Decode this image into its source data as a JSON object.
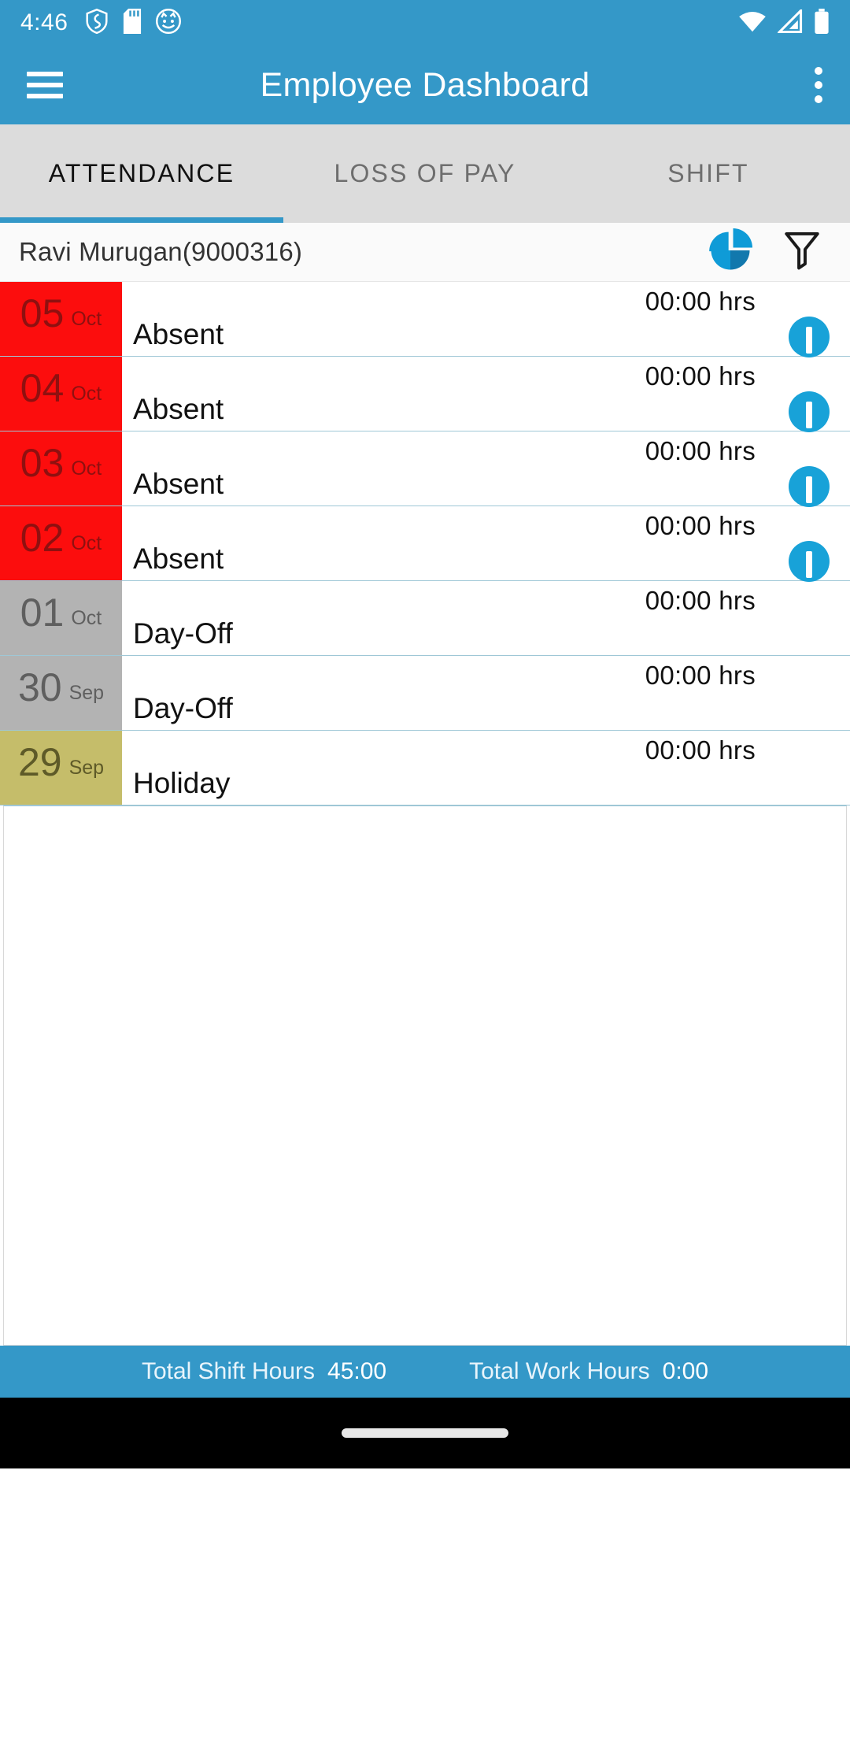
{
  "status_bar": {
    "time": "4:46",
    "left_icons": [
      "shield-icon",
      "sd-card-icon",
      "cat-face-icon"
    ],
    "right_icons": [
      "wifi-icon",
      "cellular-signal-icon",
      "battery-icon"
    ],
    "background_color": "#3498c8"
  },
  "app_bar": {
    "title": "Employee Dashboard",
    "menu_icon": "hamburger-menu-icon",
    "overflow_icon": "more-vertical-icon",
    "background_color": "#3498c8"
  },
  "tabs": {
    "active_index": 0,
    "indicator_color": "#3498c8",
    "items": [
      {
        "label": "ATTENDANCE"
      },
      {
        "label": "LOSS OF PAY"
      },
      {
        "label": "SHIFT"
      }
    ]
  },
  "employee_bar": {
    "name": "Ravi  Murugan(9000316)",
    "chart_icon": "pie-chart-icon",
    "filter_icon": "filter-funnel-icon"
  },
  "attendance": {
    "colors": {
      "absent": "#fc0d0d",
      "day_off": "#b3b3b3",
      "holiday": "#c5bd6a",
      "info_badge": "#18a2d8"
    },
    "rows": [
      {
        "day": "05",
        "month": "Oct",
        "status": "Absent",
        "hours": "00:00 hrs",
        "type": "absent",
        "has_info": true
      },
      {
        "day": "04",
        "month": "Oct",
        "status": "Absent",
        "hours": "00:00 hrs",
        "type": "absent",
        "has_info": true
      },
      {
        "day": "03",
        "month": "Oct",
        "status": "Absent",
        "hours": "00:00 hrs",
        "type": "absent",
        "has_info": true
      },
      {
        "day": "02",
        "month": "Oct",
        "status": "Absent",
        "hours": "00:00 hrs",
        "type": "absent",
        "has_info": true
      },
      {
        "day": "01",
        "month": "Oct",
        "status": "Day-Off",
        "hours": "00:00 hrs",
        "type": "dayoff",
        "has_info": false
      },
      {
        "day": "30",
        "month": "Sep",
        "status": "Day-Off",
        "hours": "00:00 hrs",
        "type": "dayoff",
        "has_info": false
      },
      {
        "day": "29",
        "month": "Sep",
        "status": "Holiday",
        "hours": "00:00 hrs",
        "type": "holiday",
        "has_info": false
      }
    ]
  },
  "summary": {
    "shift_label": "Total Shift Hours",
    "shift_value": "45:00",
    "work_label": "Total Work Hours",
    "work_value": "0:00",
    "background_color": "#3498c8"
  }
}
